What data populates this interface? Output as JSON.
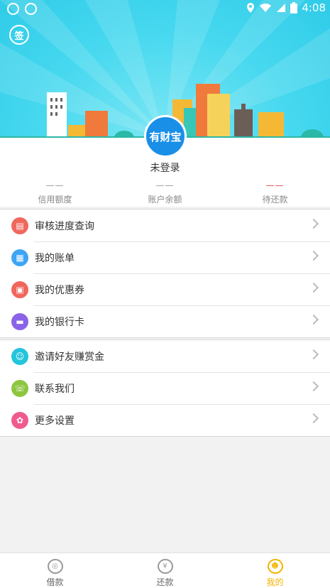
{
  "status_bar": {
    "time": "4:08"
  },
  "header": {
    "sign_label": "签",
    "brand": "有财宝"
  },
  "profile": {
    "login_status": "未登录"
  },
  "stats": [
    {
      "value": "——",
      "label": "信用额度"
    },
    {
      "value": "——",
      "label": "账户余额"
    },
    {
      "value": "——",
      "label": "待还款"
    }
  ],
  "menu_group_1": [
    {
      "label": "审核进度查询",
      "icon": "review-icon",
      "color": "#f0675c"
    },
    {
      "label": "我的账单",
      "icon": "bill-icon",
      "color": "#3ea5f5"
    },
    {
      "label": "我的优惠券",
      "icon": "coupon-icon",
      "color": "#f0675c"
    },
    {
      "label": "我的银行卡",
      "icon": "bankcard-icon",
      "color": "#8a63e8"
    }
  ],
  "menu_group_2": [
    {
      "label": "邀请好友赚赏金",
      "icon": "invite-icon",
      "color": "#23c4dc"
    },
    {
      "label": "联系我们",
      "icon": "headset-icon",
      "color": "#8dc63f"
    },
    {
      "label": "更多设置",
      "icon": "settings-icon",
      "color": "#ef5b8f"
    }
  ],
  "tabs": [
    {
      "label": "借款",
      "icon": "borrow-icon",
      "active": false
    },
    {
      "label": "还款",
      "icon": "repay-icon",
      "active": false
    },
    {
      "label": "我的",
      "icon": "profile-icon",
      "active": true
    }
  ],
  "colors": {
    "accent": "#f0b400",
    "header_bg": "#46d8ef",
    "alert_red": "#e24a4a"
  }
}
